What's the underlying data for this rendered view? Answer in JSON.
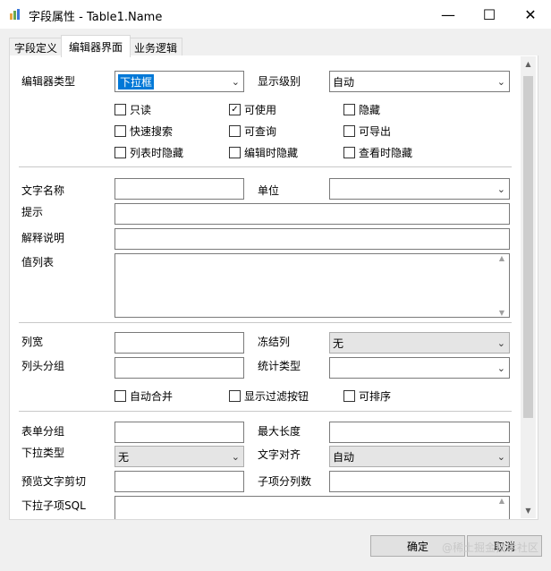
{
  "window": {
    "title": "字段属性 - Table1.Name",
    "minimize_glyph": "—",
    "maximize_glyph": "☐",
    "close_glyph": "✕",
    "icon": "app-icon"
  },
  "tabs": [
    {
      "label": "字段定义",
      "active": false
    },
    {
      "label": "编辑器界面",
      "active": true
    },
    {
      "label": "业务逻辑",
      "active": false
    }
  ],
  "editor": {
    "editor_type_label": "编辑器类型",
    "editor_type_value": "下拉框",
    "display_level_label": "显示级别",
    "display_level_value": "自动",
    "checks": [
      {
        "label": "只读",
        "checked": false
      },
      {
        "label": "可使用",
        "checked": true
      },
      {
        "label": "隐藏",
        "checked": false
      },
      {
        "label": "快速搜索",
        "checked": false
      },
      {
        "label": "可查询",
        "checked": false
      },
      {
        "label": "可导出",
        "checked": false
      },
      {
        "label": "列表时隐藏",
        "checked": false
      },
      {
        "label": "编辑时隐藏",
        "checked": false
      },
      {
        "label": "查看时隐藏",
        "checked": false
      }
    ]
  },
  "text": {
    "display_name_label": "文字名称",
    "display_name_value": "",
    "unit_label": "单位",
    "unit_value": "",
    "hint_label": "提示",
    "hint_value": "",
    "explain_label": "解释说明",
    "explain_value": "",
    "value_list_label": "值列表",
    "value_list_value": ""
  },
  "list": {
    "col_width_label": "列宽",
    "col_width_value": "",
    "freeze_label": "冻结列",
    "freeze_value": "无",
    "header_group_label": "列头分组",
    "header_group_value": "",
    "stat_type_label": "统计类型",
    "stat_type_value": "",
    "checks": [
      {
        "label": "自动合并",
        "checked": false
      },
      {
        "label": "显示过滤按钮",
        "checked": false
      },
      {
        "label": "可排序",
        "checked": false
      }
    ]
  },
  "form": {
    "form_group_label": "表单分组",
    "form_group_value": "",
    "max_length_label": "最大长度",
    "max_length_value": "",
    "dropdown_type_label": "下拉类型",
    "dropdown_type_value": "无",
    "text_align_label": "文字对齐",
    "text_align_value": "自动",
    "preview_cut_label": "预览文字剪切",
    "preview_cut_value": "",
    "subitem_cols_label": "子项分列数",
    "subitem_cols_value": "",
    "dropdown_sql_label": "下拉子项SQL",
    "dropdown_sql_value": ""
  },
  "buttons": {
    "ok": "确定",
    "cancel": "取消"
  },
  "watermark": "@稀土掘金技术社区",
  "colors": {
    "accent": "#0078d7",
    "titlebar": "#ffffff",
    "dialog_bg": "#f0f0f0"
  }
}
